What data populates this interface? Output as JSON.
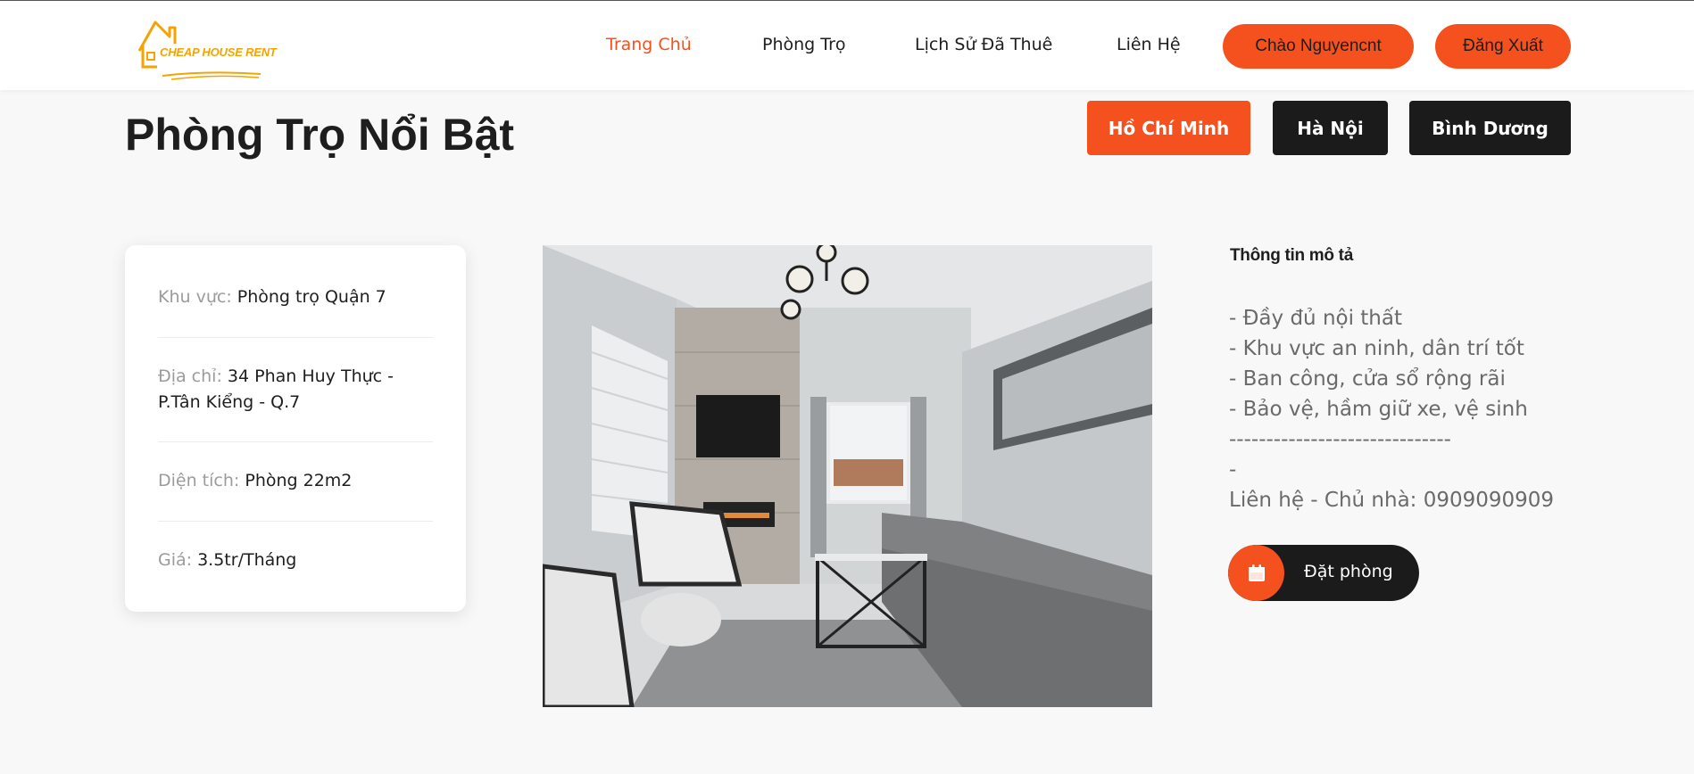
{
  "header": {
    "logo_text": "CHEAP HOUSE RENT",
    "nav": [
      {
        "label": "Trang Chủ",
        "active": true
      },
      {
        "label": "Phòng Trọ",
        "active": false
      },
      {
        "label": "Lịch Sử Đã Thuê",
        "active": false
      },
      {
        "label": "Liên Hệ",
        "active": false
      }
    ],
    "greeting_button": "Chào Nguyencnt",
    "logout_button": "Đăng Xuất"
  },
  "main": {
    "title": "Phòng Trọ Nổi Bật",
    "cities": [
      {
        "label": "Hồ Chí Minh",
        "active": true
      },
      {
        "label": "Hà Nội",
        "active": false
      },
      {
        "label": "Bình Dương",
        "active": false
      }
    ],
    "listing": {
      "rows": [
        {
          "label": "Khu vực:",
          "value": "Phòng trọ Quận 7"
        },
        {
          "label": "Địa chỉ:",
          "value": "34 Phan Huy Thực - P.Tân Kiểng - Q.7"
        },
        {
          "label": "Diện tích:",
          "value": "Phòng 22m2"
        },
        {
          "label": "Giá:",
          "value": "3.5tr/Tháng"
        }
      ],
      "description_title": "Thông tin mô tả",
      "description_lines": [
        "- Đầy đủ nội thất",
        "- Khu vực an ninh, dân trí tốt",
        "- Ban công, cửa sổ rộng rãi",
        "- Bảo vệ, hầm giữ xe, vệ sinh",
        "------------------------------",
        "-",
        "Liên hệ - Chủ nhà: 0909090909"
      ],
      "book_button": "Đặt phòng",
      "book_icon": "calendar-icon"
    }
  },
  "colors": {
    "accent": "#f4511e",
    "logo": "#f5a300",
    "dark": "#1b1b1b",
    "background": "#f8f8f8"
  }
}
